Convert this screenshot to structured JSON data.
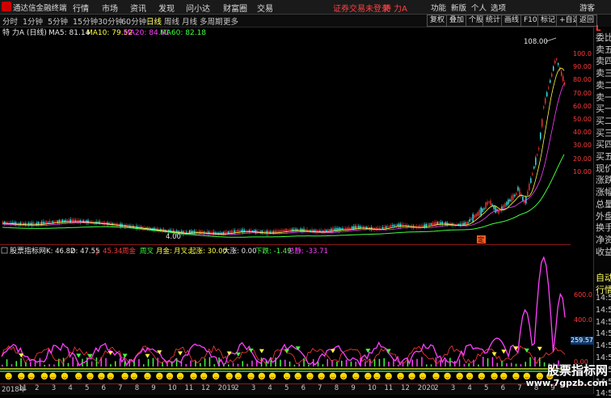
{
  "app": {
    "name": "通达信金融终端",
    "menu": [
      "行情",
      "市场",
      "资讯",
      "发现",
      "问小达",
      "财富圈",
      "交易"
    ],
    "login_warning": "证券交易未登录",
    "stock_short": "特 力A",
    "right_tools": [
      "功能",
      "新版",
      "个人",
      "选项",
      "游客"
    ]
  },
  "periodbar": {
    "tabs": [
      "分时",
      "1分钟",
      "5分钟",
      "15分钟",
      "30分钟",
      "60分钟",
      "日线",
      "周线",
      "月线",
      "多周期",
      "更多"
    ],
    "active_tab": "日线",
    "buttons": [
      "复权",
      "叠加",
      "个股",
      "统计",
      "画线",
      "F10",
      "标记",
      "+自选",
      "返回"
    ]
  },
  "main_chart": {
    "stock_label": "特 力A (日线)",
    "ma": [
      {
        "label": "MA5: 81.14",
        "color": "#e8e8e8"
      },
      {
        "label": "MA10: 79.52",
        "color": "#ffff40"
      },
      {
        "label": "MA20: 84.61",
        "color": "#ff40ff"
      },
      {
        "label": "MA60: 82.18",
        "color": "#40ff40"
      }
    ],
    "high_label": "108.00",
    "low_label": "4.00",
    "marker_label": "定",
    "y_ticks": [
      "100.0",
      "90.00",
      "80.00",
      "70.00",
      "60.00",
      "50.00",
      "40.00",
      "30.00",
      "20.00",
      "10.00"
    ]
  },
  "sub_chart": {
    "title": "股票指标网",
    "labels": [
      {
        "text": "K: 46.82",
        "color": "#e8e8e8"
      },
      {
        "text": "D: 47.55",
        "color": "#e8e8e8"
      },
      {
        "text": "J: 45.34",
        "color": "#ff3b3b"
      },
      {
        "text": "周金",
        "color": "#ff3b3b"
      },
      {
        "text": "周叉",
        "color": "#40ff40"
      },
      {
        "text": "月金:",
        "color": "#ffff40"
      },
      {
        "text": "月叉:",
        "color": "#ffff40"
      },
      {
        "text": "起涨: 30.00",
        "color": "#ffff40"
      },
      {
        "text": "大涨: 0.00",
        "color": "#e8e8e8"
      },
      {
        "text": "下跌: -1.49",
        "color": "#40ff40"
      },
      {
        "text": "总静: -33.71",
        "color": "#ff40ff"
      }
    ],
    "y_ticks": [
      "600.0",
      "400.0",
      "200.0",
      "0.00"
    ],
    "value_box": "259.57"
  },
  "right_panel": {
    "header": "L",
    "items": [
      "委比",
      "卖五",
      "卖四",
      "卖三",
      "卖二",
      "卖一",
      "买一",
      "买二",
      "买三",
      "买四",
      "买五",
      "现价",
      "涨跌",
      "涨幅",
      "总量",
      "外盘",
      "换手",
      "净资",
      "收益",
      "自动",
      "行情",
      "14:5",
      "14:5",
      "14:5",
      "14:5",
      "14:5",
      "14:5",
      "14:5",
      "14:5",
      "14:5"
    ]
  },
  "bottom_bar": {
    "dates": [
      "2018年",
      "11",
      "2",
      "3",
      "4",
      "5",
      "6",
      "7",
      "8",
      "9",
      "10",
      "11",
      "12",
      "2019",
      "2",
      "3",
      "4",
      "5",
      "6",
      "7",
      "8",
      "9",
      "10",
      "11",
      "12",
      "2020",
      "2",
      "3",
      "4",
      "5",
      "6",
      "7",
      "8",
      "9"
    ]
  },
  "watermark": {
    "title": "股票指标网",
    "url": "www.7gpzb.com"
  },
  "colors": {
    "up": "#ff3b3b",
    "down": "#40ff40",
    "ma5": "#e8e8e8",
    "ma10": "#ffff40",
    "ma20": "#ff40ff",
    "ma60": "#40ff40"
  }
}
